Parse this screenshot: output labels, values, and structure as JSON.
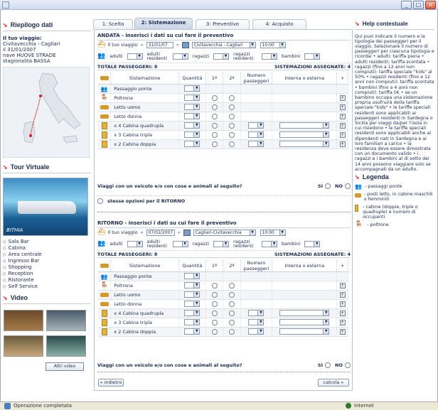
{
  "statusbar": {
    "status": "Operazione completata",
    "zone": "Internet"
  },
  "left": {
    "riepilogo_title": "Riepilogo dati",
    "trip_title": "Il tuo viaggio:",
    "trip_lines": [
      "Civitavecchia - Cagliari",
      "il 31/01/2007",
      "nave HUOVE STRADE",
      "stagionalità BASSA"
    ],
    "tour_title": "Tour Virtuale",
    "ship_name": "BITHIA",
    "tour_items": [
      "Sala Bar",
      "Cabina",
      "Area centrale",
      "Ingresso Bar",
      "Shopping",
      "Reception",
      "Ristorante",
      "Self Service"
    ],
    "video_title": "Video",
    "video_button": "Altri video"
  },
  "tabs": [
    "1: Scelta",
    "2: Sistemazione",
    "3: Preventivo",
    "4: Acquisto"
  ],
  "andata": {
    "header": "ANDATA - inserisci i dati su cui fare il preventivo",
    "trip_label": "Il tuo viaggio",
    "date": "31/01/07",
    "route": "Civitavecchia - Cagliari",
    "time": "10:00",
    "pax": {
      "adulti": "adulti",
      "adulti_res": "adulti residenti",
      "ragazzi": "ragazzi",
      "ragazzi_res": "ragazzi residenti",
      "bambini": "bambini"
    },
    "totale": "TOTALE PASSEGGERI: 8",
    "assegnate": "SISTEMAZIONI ASSEGNATE: 4",
    "veicolo": "Viaggi con un veicolo e/o con cose e animali al seguito?",
    "si": "SI",
    "no": "NO",
    "stesse": "stesse opzioni per il RITORNO"
  },
  "ritorno": {
    "header": "RITORNO - inserisci i dati su cui fare il preventivo",
    "trip_label": "Il tuo viaggio",
    "date": "07/02/2007",
    "route": "Cagliari-Civitavecchia",
    "time": "10:00",
    "totale": "TOTALE PASSEGGERI: 8",
    "assegnate": "SISTEMAZIONI ASSEGNATE: 4",
    "veicolo": "Viaggi con un veicolo e/o con cose e animali al seguito?"
  },
  "columns": [
    "Sistemazione",
    "Quantità",
    "1ª",
    "2ª",
    "Numero passeggeri",
    "Interna o esterna",
    "+"
  ],
  "rows": [
    {
      "label": "Passaggio ponte",
      "mult": "",
      "icon": "deck"
    },
    {
      "label": "Poltrona",
      "mult": "",
      "icon": "seat"
    },
    {
      "label": "Letto uomo",
      "mult": "",
      "icon": "bed-man"
    },
    {
      "label": "Letto donna",
      "mult": "",
      "icon": "bed-woman"
    },
    {
      "label": "Cabina quadrupla",
      "mult": "x 4",
      "icon": "cabin"
    },
    {
      "label": "Cabina tripla",
      "mult": "x 3",
      "icon": "cabin"
    },
    {
      "label": "Cabina doppia",
      "mult": "x 2",
      "icon": "cabin"
    }
  ],
  "nav": {
    "back": "« indietro",
    "next": "calcola »"
  },
  "help": {
    "title": "Help contestuale",
    "text": "Qui puoi indicare il numero e la tipologia dei passeggeri per il viaggio. Selezionare il numero di passeggeri per ciascuna tipologia e ricordai • adulti: tariffa piena • adulti residenti: tariffa scontata • ragazzi (fino a 12 anni non compiuti): tariffa speciale \"kids\" al 50% • ragazzi residenti (fino a 12 anni non compiuti): tariffa scontata • bambini (fino a 4 anni non compiuti): tariffa 0€ • se un bambino occupa una sistemazione propria usufruirà della tariffa speciale \"kids\" • le tariffe speciali residenti sono applicabili ai passeggeri residenti in Sardegna o Sicilia per viaggi da/per l'isola in cui risiedono • le tariffe speciali residenti sono applicabili anche ai dipendenti nati in Sardegna e ai loro familiari a carico • la residenza deve essere dimostrata con un documento valido • i ragazzi e i bambini al di sotto dei 14 anni possono viaggiare solo se accompagnati da un adulto.",
    "legend_title": "Legenda",
    "legend": [
      "- passaggi ponte",
      "- posti letto, in cabine maschili o femminili",
      "- cabine (doppie, triple o quadruple) e numero di occupanti",
      "- poltrone"
    ]
  }
}
